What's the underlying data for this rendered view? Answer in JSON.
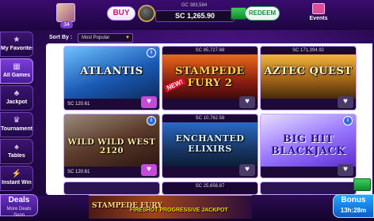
{
  "header": {
    "level": "34",
    "buy_label": "BUY",
    "gc_balance": "GC 383,584",
    "sc_balance": "SC 1,265.90",
    "redeem_label": "REDEEM",
    "events_label": "Events"
  },
  "sidebar": {
    "items": [
      {
        "label": "My Favorites",
        "icon": "star-icon"
      },
      {
        "label": "All Games",
        "icon": "grid-icon"
      },
      {
        "label": "Jackpot",
        "icon": "slot-icon"
      },
      {
        "label": "Tournaments",
        "icon": "trophy-icon"
      },
      {
        "label": "Tables",
        "icon": "cards-icon"
      },
      {
        "label": "Instant Win",
        "icon": "lightning-icon"
      }
    ],
    "active_index": 1
  },
  "sort": {
    "label": "Sort By :",
    "selected": "Most Popular"
  },
  "games": [
    {
      "title": "ATLANTIS",
      "sc_top": "",
      "sc_bottom": "SC 120.61",
      "favorite": true,
      "new": false
    },
    {
      "title": "STAMPEDE FURY 2",
      "sc_top": "SC 85,727.68",
      "sc_bottom": "",
      "favorite": false,
      "new": true
    },
    {
      "title": "AZTEC QUEST",
      "sc_top": "SC 171,394.92",
      "sc_bottom": "",
      "favorite": false,
      "new": false
    },
    {
      "title": "WILD WILD WEST 2120",
      "sc_top": "",
      "sc_bottom": "SC 120.61",
      "favorite": true,
      "new": false
    },
    {
      "title": "ENCHANTED ELIXIRS",
      "sc_top": "SC 10,762.58",
      "sc_bottom": "",
      "favorite": false,
      "new": false
    },
    {
      "title": "BIG HIT BLACKJACK",
      "sc_top": "",
      "sc_bottom": "",
      "favorite": false,
      "new": false
    }
  ],
  "partial_row": {
    "sc_middle": "SC 25,656.87"
  },
  "footer": {
    "deals_label": "Deals",
    "deals_sub": "More Deals Soon",
    "banner_game": "STAMPEDE FURY",
    "banner_text": "FIRESHOT PROGRESSIVE JACKPOT",
    "bonus_label": "Bonus",
    "bonus_timer": "13h:28m"
  },
  "colors": {
    "brand_purple": "#4a1a9a",
    "buy_pink": "#c21677",
    "redeem_green": "#148a40",
    "bonus_blue": "#0a5cc4"
  }
}
